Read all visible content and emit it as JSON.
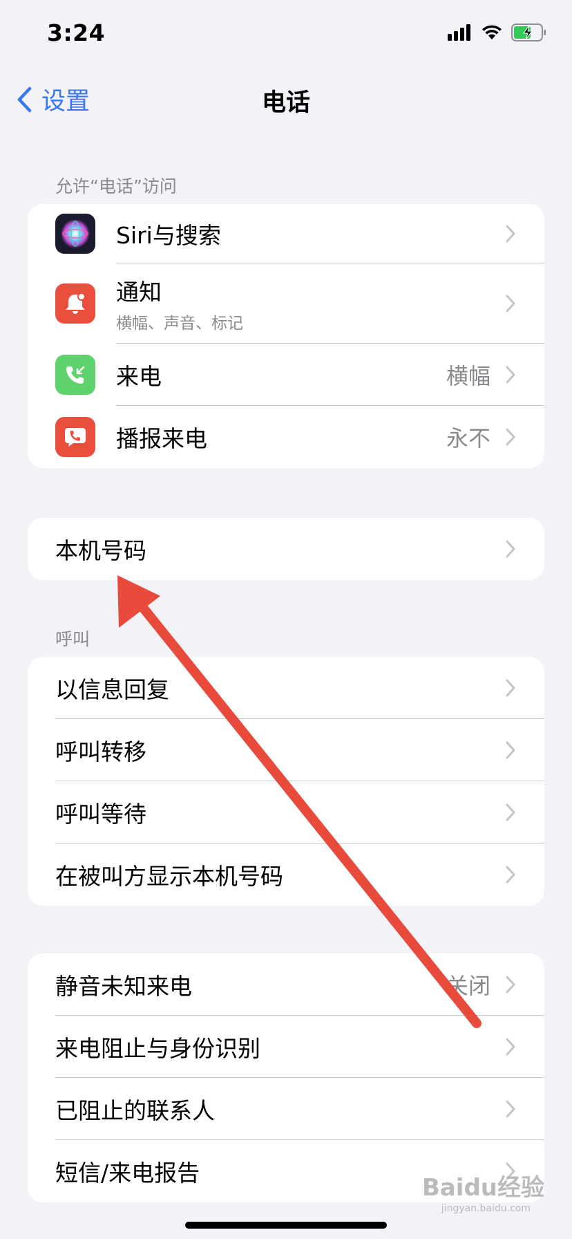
{
  "status_bar": {
    "time": "3:24"
  },
  "nav": {
    "back_label": "设置",
    "title": "电话"
  },
  "section_access": {
    "header": "允许“电话”访问",
    "items": [
      {
        "label": "Siri与搜索",
        "sub": "",
        "value": "",
        "icon": "siri-icon",
        "color": "#1b1b2e"
      },
      {
        "label": "通知",
        "sub": "横幅、声音、标记",
        "value": "",
        "icon": "notification-bell-icon",
        "color": "#ea4e3d"
      },
      {
        "label": "来电",
        "sub": "",
        "value": "横幅",
        "icon": "incoming-call-icon",
        "color": "#5ed26c"
      },
      {
        "label": "播报来电",
        "sub": "",
        "value": "永不",
        "icon": "announce-calls-icon",
        "color": "#ea4e3d"
      }
    ]
  },
  "my_number": {
    "label": "本机号码"
  },
  "section_calls": {
    "header": "呼叫",
    "items": [
      {
        "label": "以信息回复",
        "value": ""
      },
      {
        "label": "呼叫转移",
        "value": ""
      },
      {
        "label": "呼叫等待",
        "value": ""
      },
      {
        "label": "在被叫方显示本机号码",
        "value": ""
      }
    ]
  },
  "section_block": {
    "items": [
      {
        "label": "静音未知来电",
        "value": "关闭"
      },
      {
        "label": "来电阻止与身份识别",
        "value": ""
      },
      {
        "label": "已阻止的联系人",
        "value": ""
      },
      {
        "label": "短信/来电报告",
        "value": ""
      }
    ]
  },
  "annotation": {
    "arrow_color": "#e84a3c"
  },
  "watermark": {
    "logo": "Baidu经验",
    "url": "jingyan.baidu.com"
  }
}
